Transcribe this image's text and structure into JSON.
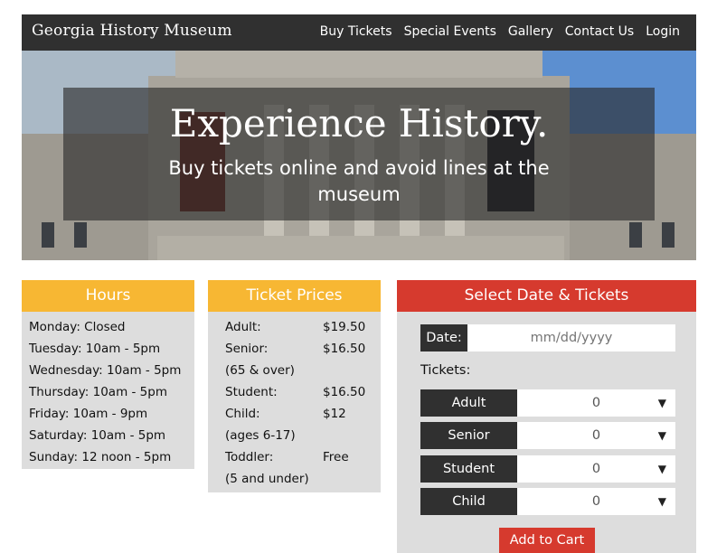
{
  "header": {
    "brand": "Georgia History Museum",
    "nav": [
      "Buy Tickets",
      "Special Events",
      "Gallery",
      "Contact Us",
      "Login"
    ]
  },
  "hero": {
    "title": "Experience History.",
    "subtitle": "Buy tickets online and avoid lines at the museum"
  },
  "hours": {
    "title": "Hours",
    "items": [
      "Monday: Closed",
      "Tuesday: 10am - 5pm",
      "Wednesday: 10am - 5pm",
      "Thursday: 10am - 5pm",
      "Friday: 10am - 9pm",
      "Saturday: 10am - 5pm",
      "Sunday: 12 noon - 5pm"
    ]
  },
  "prices": {
    "title": "Ticket Prices",
    "rows": [
      {
        "name": "Adult:",
        "price": "$19.50"
      },
      {
        "name": "Senior:",
        "price": "$16.50"
      },
      {
        "name": "(65 & over)",
        "price": ""
      },
      {
        "name": "Student:",
        "price": "$16.50"
      },
      {
        "name": "Child:",
        "price": "$12"
      },
      {
        "name": "(ages 6-17)",
        "price": ""
      },
      {
        "name": "Toddler:",
        "price": "Free"
      },
      {
        "name": "(5 and under)",
        "price": ""
      }
    ]
  },
  "tickets": {
    "title": "Select Date & Tickets",
    "date_label": "Date:",
    "date_placeholder": "mm/dd/yyyy",
    "tickets_label": "Tickets:",
    "types": [
      {
        "label": "Adult",
        "value": "0"
      },
      {
        "label": "Senior",
        "value": "0"
      },
      {
        "label": "Student",
        "value": "0"
      },
      {
        "label": "Child",
        "value": "0"
      }
    ],
    "add_to_cart": "Add to Cart"
  },
  "colors": {
    "header_bg": "#303030",
    "accent_yellow": "#f7b733",
    "accent_red": "#d63a2e",
    "panel_bg": "#dddddd"
  }
}
